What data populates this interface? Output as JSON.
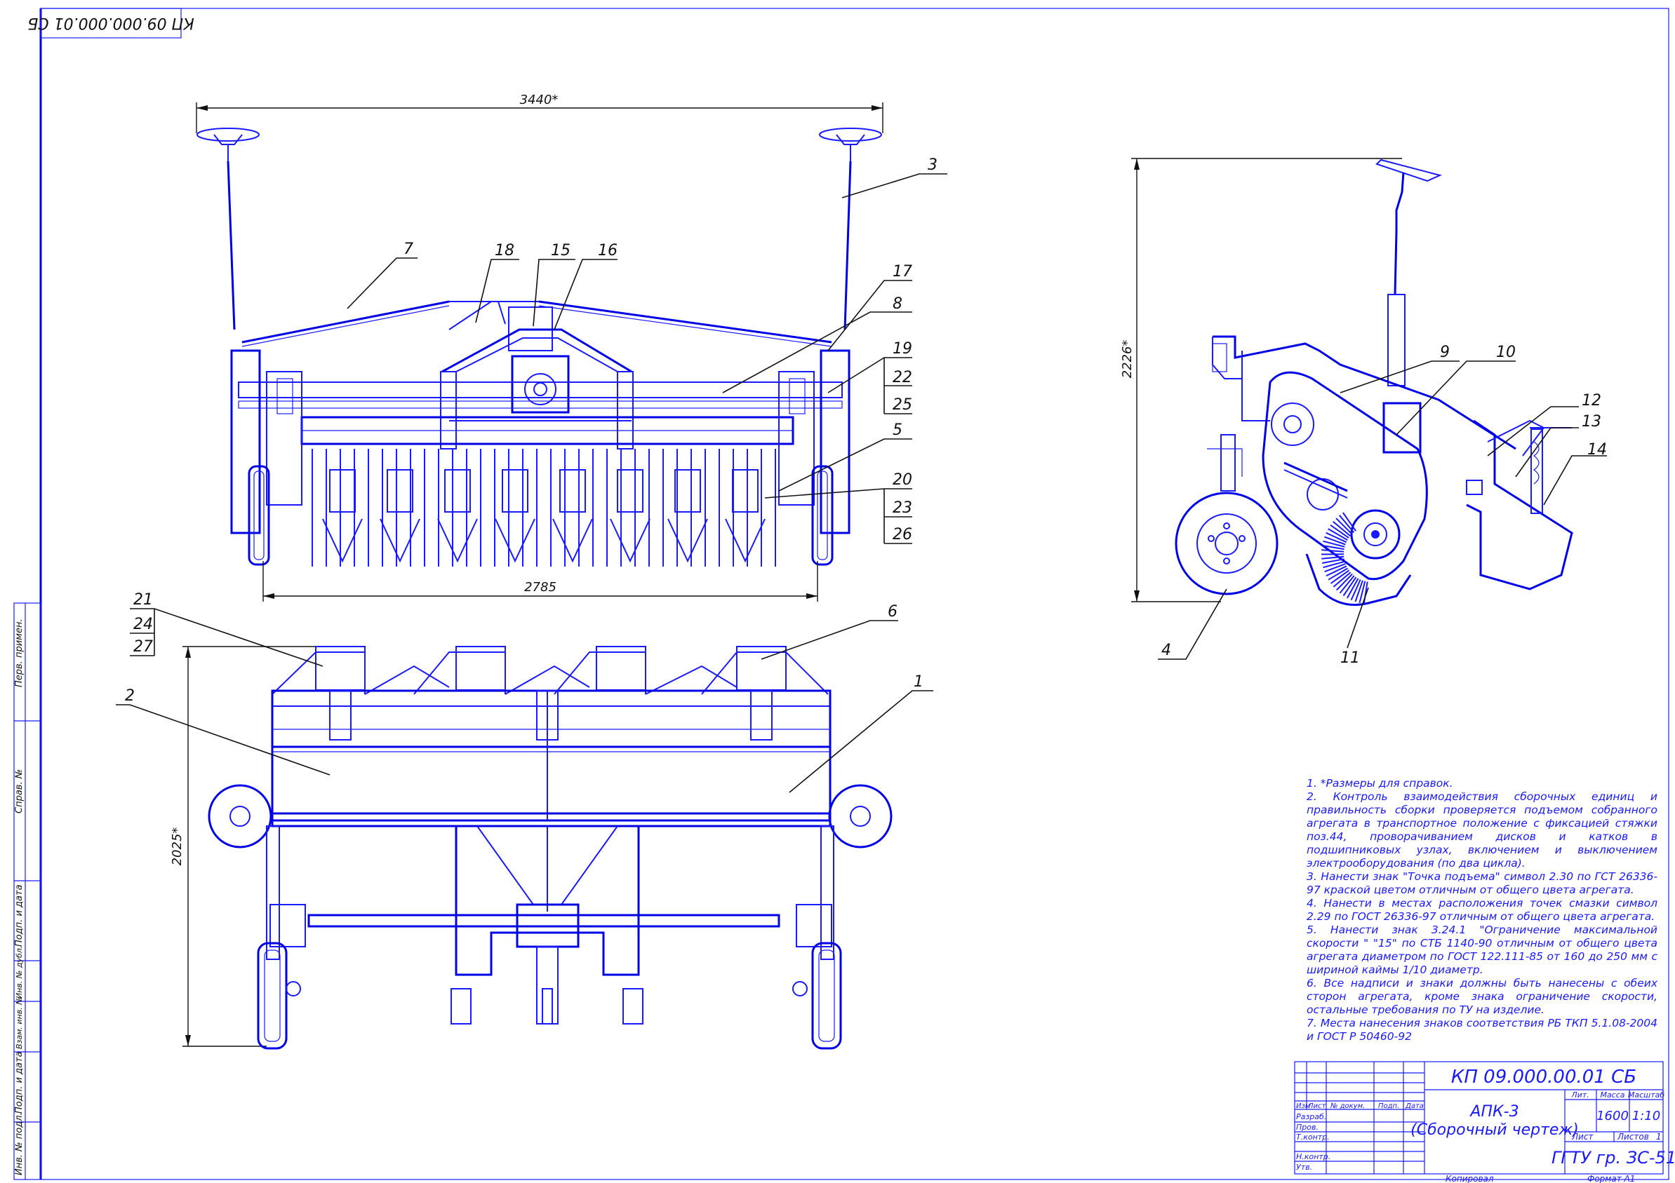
{
  "doc_code_top": "КП 09.000.000.01 СБ",
  "title_block": {
    "code": "КП 09.000.00.01 СБ",
    "name_line1": "АПК-3",
    "name_line2": "(Сборочный чертеж)",
    "col_lit": "Лит.",
    "col_mass": "Масса",
    "col_scale": "Масштаб",
    "mass": "1600",
    "scale": "1:10",
    "sheet_label": "Лист",
    "sheets_label": "Листов",
    "sheets_count": "1",
    "org": "ГГТУ гр. ЗС-51",
    "hdr_izm": "Изм",
    "hdr_list": "Лист",
    "hdr_doc": "№ докум.",
    "hdr_sign": "Подп.",
    "hdr_date": "Дата",
    "row_razrab": "Разраб.",
    "row_prov": "Пров.",
    "row_tkontr": "Т.контр.",
    "row_nkontr": "Н.контр.",
    "row_utv": "Утв.",
    "copied": "Копировал",
    "format": "Формат   А1"
  },
  "side_strip": {
    "perv_primen": "Перв. примен.",
    "sprav": "Справ. №",
    "podp_data_1": "Подп. и дата",
    "inv_dubl": "Инв. № дубл.",
    "vzam_inv": "Взам. инв. №",
    "podp_data_2": "Подп. и дата",
    "inv_podl": "Инв. № подл."
  },
  "dimensions": {
    "width_top": "3440*",
    "width_bottom": "2785",
    "height_side": "2226*",
    "length_plan": "2025*"
  },
  "callouts": {
    "c1": "1",
    "c2": "2",
    "c3": "3",
    "c4": "4",
    "c5": "5",
    "c6": "6",
    "c7": "7",
    "c8": "8",
    "c9": "9",
    "c10": "10",
    "c11": "11",
    "c12": "12",
    "c13": "13",
    "c14": "14",
    "c15": "15",
    "c16": "16",
    "c17": "17",
    "c18": "18",
    "c19": "19",
    "c20": "20",
    "c21": "21",
    "c22": "22",
    "c23": "23",
    "c24": "24",
    "c25": "25",
    "c26": "26",
    "c27": "27"
  },
  "notes": [
    "1.  *Размеры для справок.",
    "2. Контроль взаимодействия сборочных единиц и правильность сборки проверяется подъемом собранного агрегата в транспортное положение  с фиксацией стяжки поз.44, проворачиванием дисков и катков в подшипниковых узлах, включением и выключением электрооборудования (по два цикла).",
    "3. Нанести знак \"Точка подъема\" символ 2.30 по ГСТ 26336-97 краской цветом отличным от общего цвета агрегата.",
    "4. Нанести в местах расположения точек смазки символ 2.29 по ГОСТ 26336-97 отличным от общего цвета агрегата.",
    "5. Нанести знак 3.24.1 \"Ограничение максимальной скорости \" \"15\" по СТБ 1140-90  отличным от общего цвета агрегата диаметром по ГОСТ 122.111-85 от 160  до 250 мм с шириной каймы 1/10 диаметр.",
    "6. Все надписи и знаки должны быть нанесены с обеих сторон агрегата, кроме  знака ограничение скорости, остальные требования по ТУ на изделие.",
    "7. Места нанесения знаков соответствия РБ ТКП 5.1.08-2004 и ГОСТ Р 50460-92"
  ],
  "colors": {
    "line": "#1a1aff",
    "text": "#111111",
    "frame": "#1a1aff"
  }
}
